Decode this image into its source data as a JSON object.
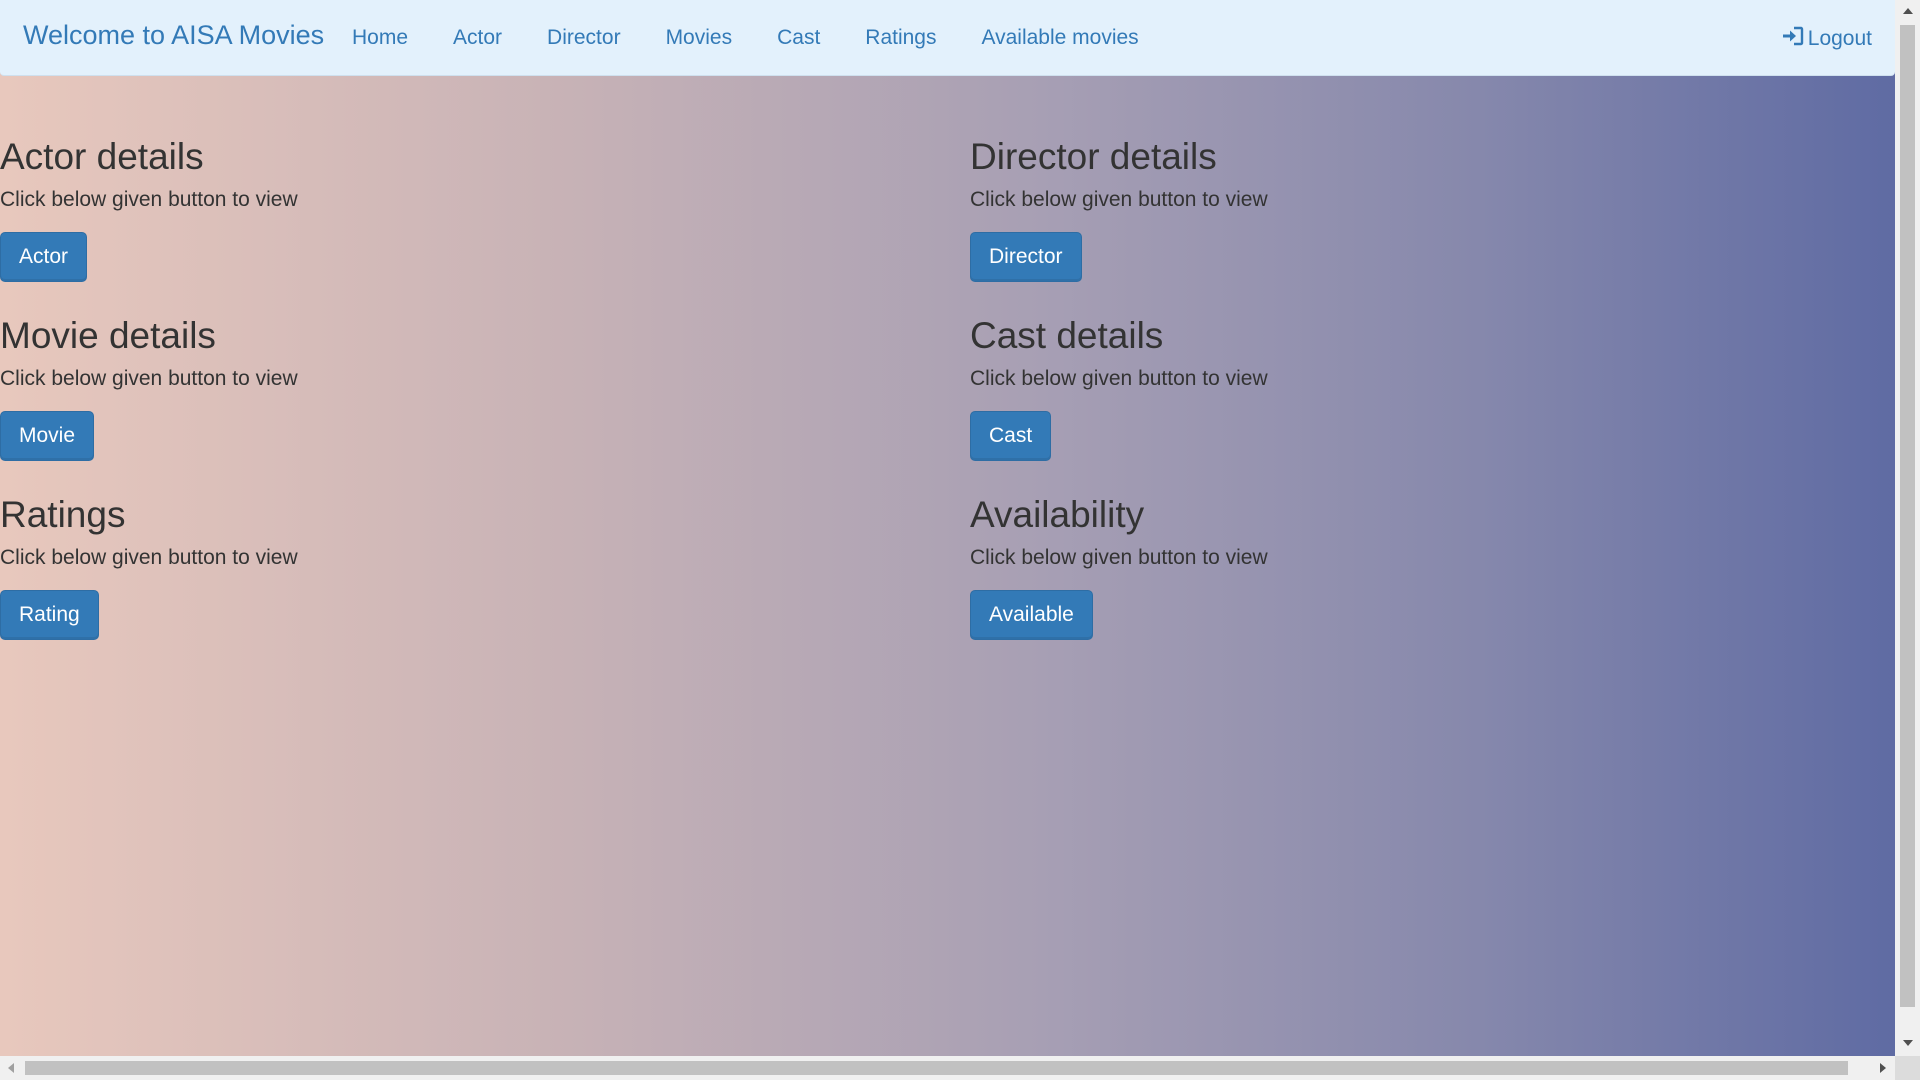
{
  "navbar": {
    "brand": "Welcome to AISA Movies",
    "links": [
      "Home",
      "Actor",
      "Director",
      "Movies",
      "Cast",
      "Ratings",
      "Available movies"
    ],
    "logout_label": "Logout",
    "logout_icon": "log-in-icon"
  },
  "sections": [
    {
      "heading": "Actor details",
      "description": "Click below given button to view",
      "button": "Actor"
    },
    {
      "heading": "Director details",
      "description": "Click below given button to view",
      "button": "Director"
    },
    {
      "heading": "Movie details",
      "description": "Click below given button to view",
      "button": "Movie"
    },
    {
      "heading": "Cast details",
      "description": "Click below given button to view",
      "button": "Cast"
    },
    {
      "heading": "Ratings",
      "description": "Click below given button to view",
      "button": "Rating"
    },
    {
      "heading": "Availability",
      "description": "Click below given button to view",
      "button": "Available"
    }
  ],
  "colors": {
    "navbar_bg": "#e3f1fc",
    "link": "#337ab7",
    "button_bg": "#337ab7",
    "text": "#333333",
    "gradient_start": "#e8c8bd",
    "gradient_end": "#5f6ba3"
  }
}
